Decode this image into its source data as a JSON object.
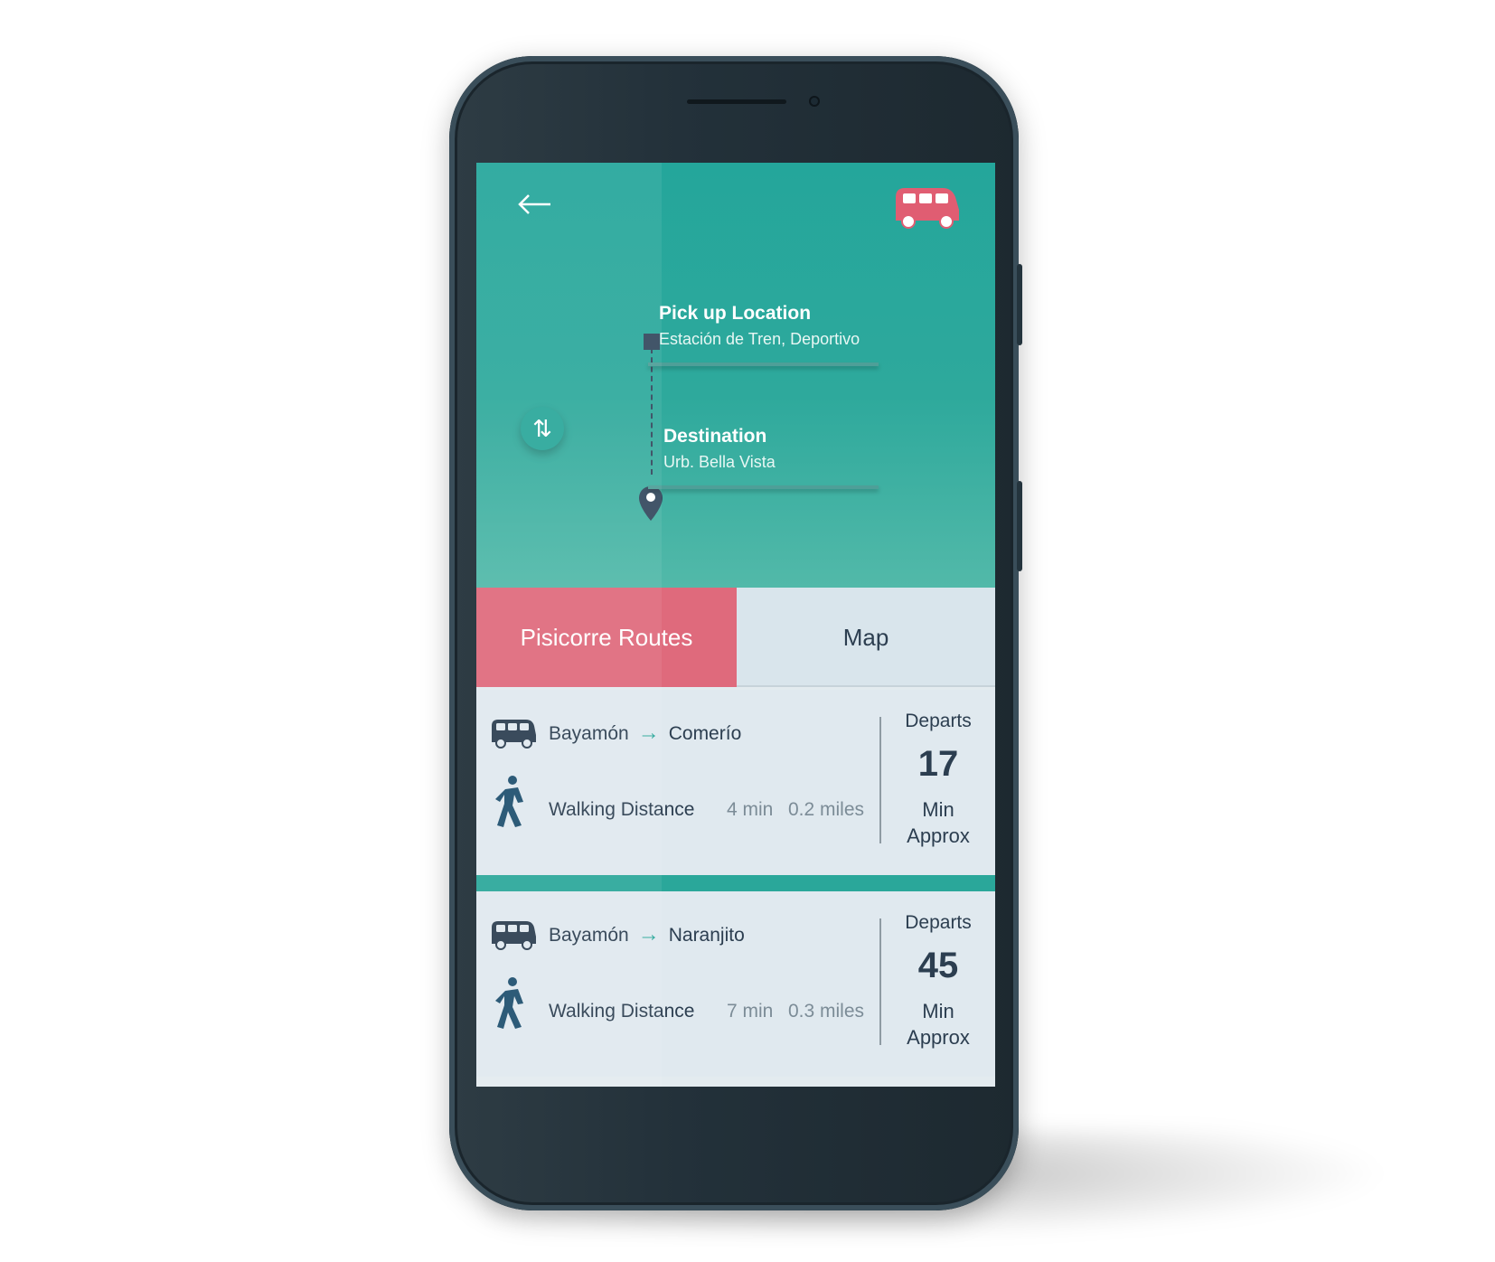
{
  "header": {
    "back_icon": "arrow-left-icon",
    "bus_icon": "bus-icon",
    "pickup": {
      "label": "Pick up Location",
      "value": "Estación de Tren, Deportivo"
    },
    "destination": {
      "label": "Destination",
      "value": "Urb. Bella Vista"
    },
    "swap_icon": "swap-vertical-icon",
    "swap_glyph": "⇅"
  },
  "tabs": [
    {
      "label": "Pisicorre Routes",
      "active": true
    },
    {
      "label": "Map",
      "active": false
    }
  ],
  "routes": [
    {
      "from": "Bayamón",
      "arrow": "→",
      "to": "Comerío",
      "walk_label": "Walking Distance",
      "walk_time": "4 min",
      "walk_distance": "0.2 miles",
      "departs_label": "Departs",
      "departs_value": "17",
      "departs_unit": "Min",
      "departs_note": "Approx"
    },
    {
      "from": "Bayamón",
      "arrow": "→",
      "to": "Naranjito",
      "walk_label": "Walking Distance",
      "walk_time": "7 min",
      "walk_distance": "0.3 miles",
      "departs_label": "Departs",
      "departs_value": "45",
      "departs_unit": "Min",
      "departs_note": "Approx"
    }
  ],
  "colors": {
    "header": "#2ea99c",
    "accent": "#df6a7c",
    "dark": "#2c3e50",
    "card": "#e0e9ef"
  }
}
